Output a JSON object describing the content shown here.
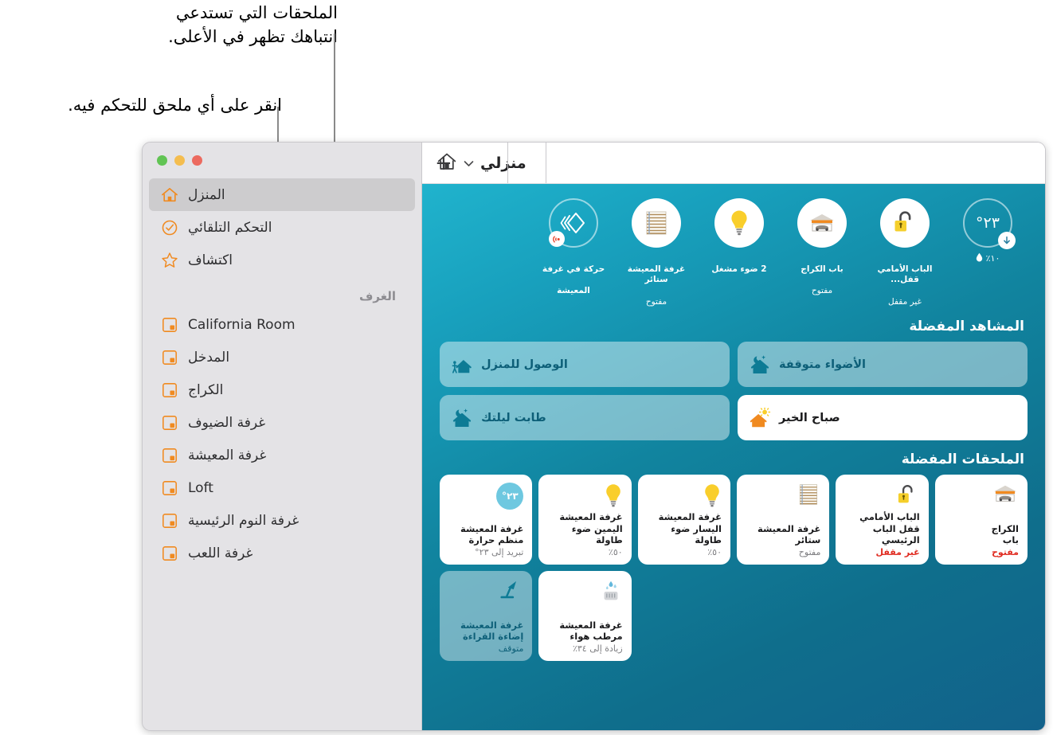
{
  "callouts": [
    {
      "id": "callout-accessories-top",
      "text": "الملحقات التي تستدعي\nانتباهك تظهر في الأعلى."
    },
    {
      "id": "callout-tap-accessory",
      "text": "انقر على أي ملحق للتحكم فيه."
    }
  ],
  "window": {
    "traffic_lights": {
      "close_color": "#ec6a5f",
      "minimize_color": "#f4bd4f",
      "zoom_color": "#61c454"
    }
  },
  "toolbar": {
    "home_title": "منزلي",
    "home_icon": "house-icon",
    "chevron_icon": "chevron-down-icon",
    "add_label": "+"
  },
  "sidebar": {
    "items": [
      {
        "label": "المنزل",
        "icon": "house-icon",
        "selected": true
      },
      {
        "label": "التحكم التلقائي",
        "icon": "clock-check-icon",
        "selected": false
      },
      {
        "label": "اكتشاف",
        "icon": "star-icon",
        "selected": false
      }
    ],
    "rooms_header": "الغرف",
    "rooms": [
      {
        "label": "California Room",
        "icon": "room-icon"
      },
      {
        "label": "المدخل",
        "icon": "room-icon"
      },
      {
        "label": "الكراج",
        "icon": "room-icon"
      },
      {
        "label": "غرفة الضيوف",
        "icon": "room-icon"
      },
      {
        "label": "غرفة المعيشة",
        "icon": "room-icon"
      },
      {
        "label": "Loft",
        "icon": "room-icon"
      },
      {
        "label": "غرفة النوم الرئيسية",
        "icon": "room-icon"
      },
      {
        "label": "غرفة اللعب",
        "icon": "room-icon"
      }
    ]
  },
  "status_strip": [
    {
      "icon": "thermometer-circle",
      "value": "٢٣°",
      "badge": "arrow-down-icon",
      "humidity": "١٠٪",
      "humidity_icon": "water-drop-icon",
      "type": "climate"
    },
    {
      "icon": "lock-open-icon",
      "title": "الباب الأمامي قفل...",
      "state": "غير مقفل",
      "type": "white"
    },
    {
      "icon": "garage-icon",
      "title": "باب الكراج",
      "state": "مفتوح",
      "type": "white"
    },
    {
      "icon": "lightbulb-icon",
      "title": "2 ضوء مشغل",
      "state": "",
      "type": "white"
    },
    {
      "icon": "blinds-icon",
      "title": "غرفة المعيشة ستائر",
      "state": "مفتوح",
      "type": "white"
    },
    {
      "icon": "motion-sensor-icon",
      "title": "حركة في غرفة",
      "state": "المعيشة",
      "type": "hollow"
    }
  ],
  "scenes": {
    "header": "المشاهد المفضلة",
    "items": [
      {
        "label": "الأضواء متوقفة",
        "icon": "house-moon-icon",
        "active": false
      },
      {
        "label": "الوصول للمنزل",
        "icon": "house-walk-icon",
        "active": false
      },
      {
        "label": "صباح الخير",
        "icon": "house-sun-icon",
        "active": true
      },
      {
        "label": "طابت ليلتك",
        "icon": "house-moon-icon",
        "active": false
      }
    ]
  },
  "accessories": {
    "header": "الملحقات المفضلة",
    "row1": [
      {
        "icon": "garage-icon",
        "name": "الكراج\nباب",
        "state": "مفتوح",
        "alert": true,
        "dim": false
      },
      {
        "icon": "lock-open-icon",
        "name": "الباب الأمامي\nقفل الباب الرئيسي",
        "state": "غير مقفل",
        "alert": true,
        "dim": false
      },
      {
        "icon": "blinds-icon",
        "name": "غرفة المعيشة\nستائر",
        "state": "مفتوح",
        "alert": false,
        "dim": false
      },
      {
        "icon": "lightbulb-icon",
        "name": "غرفة المعيشة\nاليسار ضوء طاولة",
        "state": "٥٠٪",
        "alert": false,
        "dim": false
      },
      {
        "icon": "lightbulb-icon",
        "name": "غرفة المعيشة\nاليمين ضوء طاولة",
        "state": "٥٠٪",
        "alert": false,
        "dim": false
      },
      {
        "icon": "thermostat-pill",
        "pill_value": "٢٣°",
        "name": "غرفة المعيشة\nمنظم حرارة",
        "state": "تبريد إلى ٢٣°",
        "alert": false,
        "dim": false
      }
    ],
    "row2": [
      {
        "icon": "reading-lamp-icon",
        "name": "غرفة المعيشة\nإضاءة القراءة",
        "state": "متوقف",
        "alert": false,
        "dim": true
      },
      {
        "icon": "humidifier-icon",
        "name": "غرفة المعيشة\nمرطب هواء",
        "state": "زيادة إلى ٣٤٪",
        "alert": false,
        "dim": false
      }
    ]
  },
  "colors": {
    "accent_orange": "#f08a20",
    "alert_red": "#e02b20",
    "teal_top": "#20b3cd",
    "teal_bottom": "#12628b",
    "tile_white": "#ffffff",
    "tile_dim": "rgba(255,255,255,0.42)"
  }
}
